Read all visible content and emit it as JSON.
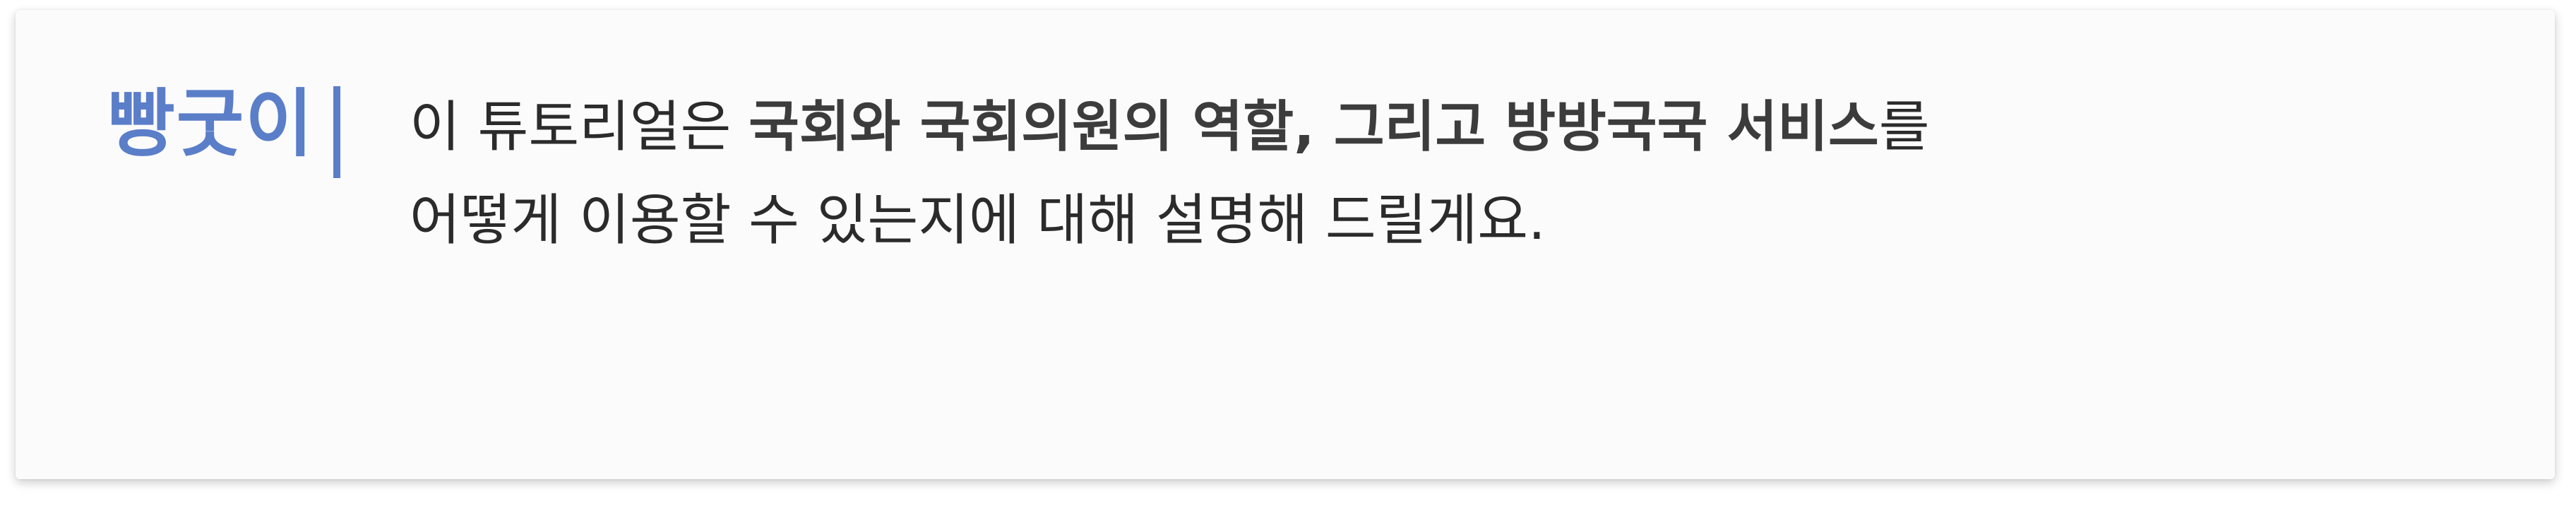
{
  "dialog": {
    "speaker_name": "빵굿이",
    "accent_color": "#5b7ec9",
    "message": {
      "line1": {
        "prefix": "이 튜토리얼은 ",
        "bold": "국회와 국회의원의 역할, 그리고 방방국국 서비스",
        "suffix": "를"
      },
      "line2": "어떻게 이용할 수 있는지에 대해 설명해 드릴게요."
    }
  }
}
